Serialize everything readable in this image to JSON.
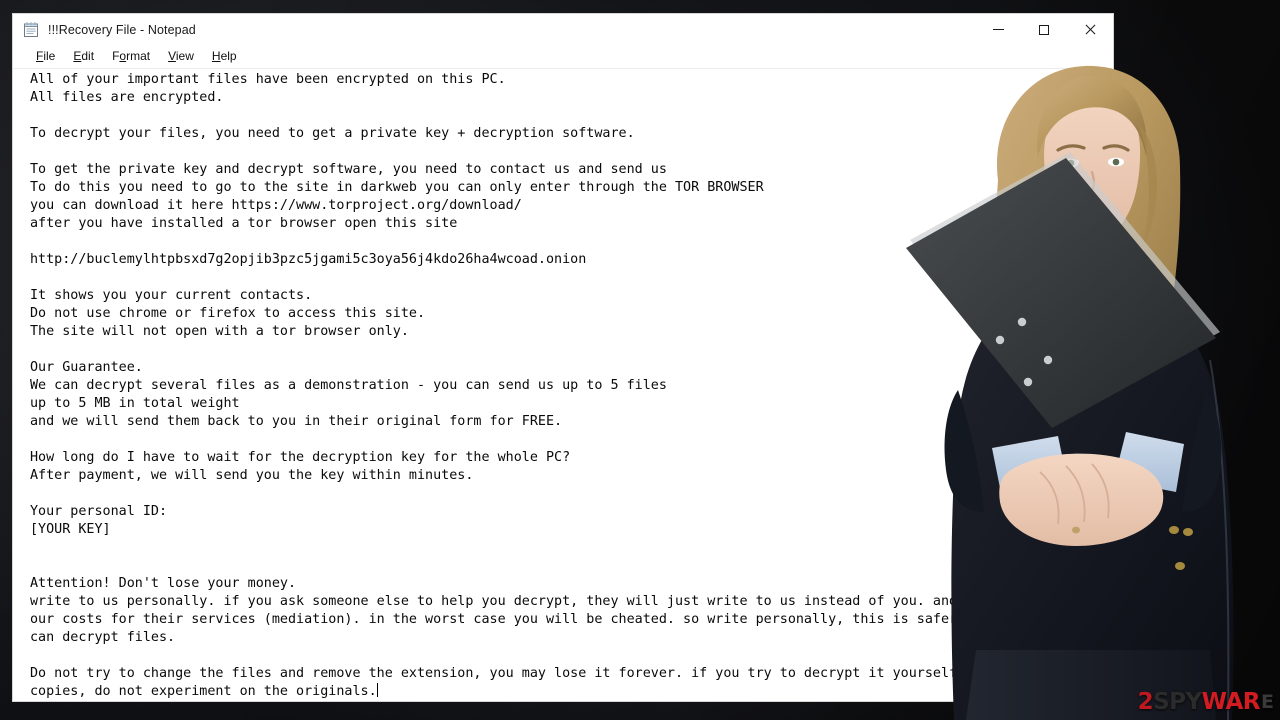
{
  "window": {
    "title": "!!!Recovery File - Notepad",
    "icon": "notepad-icon",
    "controls": {
      "minimize": "minimize-icon",
      "maximize": "maximize-icon",
      "close": "close-icon"
    }
  },
  "menu": {
    "items": [
      {
        "label": "File",
        "accel": "F"
      },
      {
        "label": "Edit",
        "accel": "E"
      },
      {
        "label": "Format",
        "accel": "o"
      },
      {
        "label": "View",
        "accel": "V"
      },
      {
        "label": "Help",
        "accel": "H"
      }
    ]
  },
  "note": {
    "text": "All of your important files have been encrypted on this PC.\nAll files are encrypted.\n\nTo decrypt your files, you need to get a private key + decryption software.\n\nTo get the private key and decrypt software, you need to contact us and send us\nTo do this you need to go to the site in darkweb you can only enter through the TOR BROWSER\nyou can download it here https://www.torproject.org/download/\nafter you have installed a tor browser open this site\n\nhttp://buclemylhtpbsxd7g2opjib3pzc5jgami5c3oya56j4kdo26ha4wcoad.onion\n\nIt shows you your current contacts.\nDo not use chrome or firefox to access this site.\nThe site will not open with a tor browser only.\n\nOur Guarantee.\nWe can decrypt several files as a demonstration - you can send us up to 5 files\nup to 5 MB in total weight\nand we will send them back to you in their original form for FREE.\n\nHow long do I have to wait for the decryption key for the whole PC?\nAfter payment, we will send you the key within minutes.\n\nYour personal ID:\n[YOUR KEY]\n\n\nAttention! Don't lose your money.\nwrite to us personally. if you ask someone else to help you decrypt, they will just write to us instead of you. and this will increase\nour costs for their services (mediation). in the worst case you will be cheated. so write personally, this is safer for you and only we\ncan decrypt files.\n\nDo not try to change the files and remove the extension, you may lose it forever. if you try to decrypt it yourself, experiment on\ncopies, do not experiment on the originals."
  },
  "scrollbar": {
    "up_arrow": "chevron-up-icon",
    "down_arrow": "chevron-down-icon"
  },
  "watermark": {
    "part1": "2",
    "part2": "SPY",
    "part3": "WAR",
    "part4": "E",
    "colors": {
      "red_dark": "#c0181f",
      "dark": "#2b2b2b",
      "red": "#d21c22"
    }
  },
  "overlay": {
    "person_alt": "businesswoman-holding-folder-photo"
  },
  "colors": {
    "desktop_background": "#17181c",
    "window_background": "#ffffff",
    "text": "#0a0a0a"
  }
}
